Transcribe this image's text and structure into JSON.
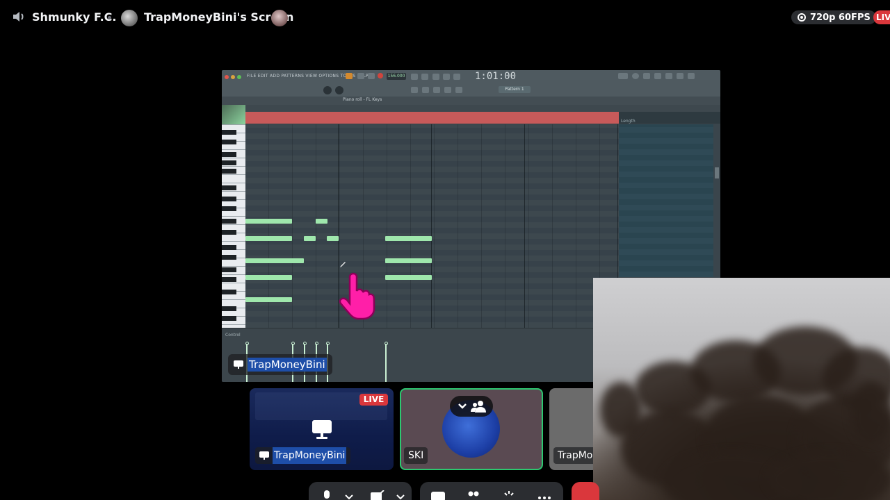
{
  "topbar": {
    "speaker_icon": "speaker-icon",
    "server_name": "Shmunky F.C.",
    "screen_title": "TrapMoneyBini's Screen",
    "quality": "720p 60FPS",
    "live_label": "LIVE"
  },
  "fl_studio": {
    "menu": "FILE  EDIT  ADD  PATTERNS  VIEW  OPTIONS  TOOLS  HELP",
    "tempo": "156.000",
    "time": "1:01:00",
    "pattern": "Pattern 1",
    "piano_roll_title": "Piano roll - FL Keys",
    "ruler_label": "Length",
    "control_label": "Control"
  },
  "stream_name": "TrapMoneyBini",
  "tiles": [
    {
      "name": "TrapMoneyBini",
      "live": "LIVE"
    },
    {
      "name": "SKI"
    },
    {
      "name": "TrapMon"
    }
  ],
  "colors": {
    "discord_bg": "#000000",
    "live_red": "#da373c",
    "speaking_green": "#2dc770",
    "fl_note_green": "#9fe7ac",
    "fl_loop_red": "#c85a5a",
    "highlight_blue": "#1e4ea8"
  }
}
